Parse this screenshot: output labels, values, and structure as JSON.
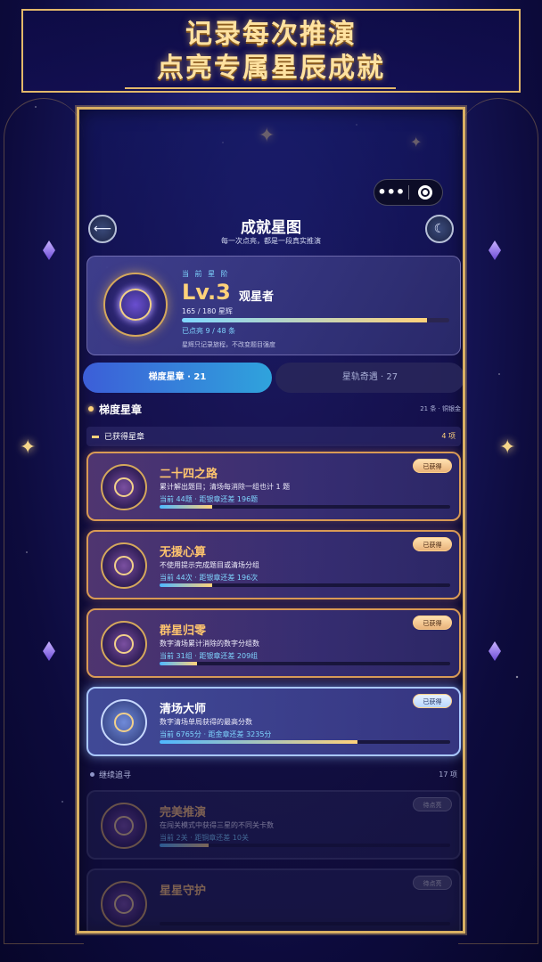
{
  "banner": {
    "line1": "记录每次推演",
    "line2": "点亮专属星辰成就"
  },
  "header": {
    "title": "成就星图",
    "subtitle": "每一次点亮，都是一段真实推演",
    "back_icon": "back-arrow-icon",
    "more_icon": "ellipsis-icon",
    "close_icon": "target-circle-icon"
  },
  "level": {
    "kicker": "当 前 星 阶",
    "value": "Lv.3",
    "name": "观星者",
    "points": "165 / 180 星辉",
    "progress": 0.917,
    "lit": "已点亮 9 / 48 条",
    "note": "星辉只记录旅程，不改变题目强度"
  },
  "tabs": [
    {
      "label": "梯度星章 · 21",
      "active": true
    },
    {
      "label": "星轨奇遇 · 27",
      "active": false
    }
  ],
  "section": {
    "title": "梯度星章",
    "meta": "21 条 · 铜银金"
  },
  "earned_group": {
    "title": "已获得星章",
    "count": "4 项"
  },
  "achievements": [
    {
      "name": "二十四之路",
      "desc": "累计解出题目；清场每消除一组也计 1 题",
      "progress_text": "当前 44题 · 距银章还差 196题",
      "progress": 0.18,
      "badge": "已获得",
      "tone": "gold"
    },
    {
      "name": "无援心算",
      "desc": "不使用提示完成题目或清场分组",
      "progress_text": "当前 44次 · 距银章还差 196次",
      "progress": 0.18,
      "badge": "已获得",
      "tone": "gold"
    },
    {
      "name": "群星归零",
      "desc": "数字清场累计消除的数字分组数",
      "progress_text": "当前 31组 · 距银章还差 209组",
      "progress": 0.13,
      "badge": "已获得",
      "tone": "gold"
    },
    {
      "name": "清场大师",
      "desc": "数字清场单局获得的最高分数",
      "progress_text": "当前 6765分 · 距金章还差 3235分",
      "progress": 0.68,
      "badge": "已获得",
      "tone": "blue"
    }
  ],
  "pending_group": {
    "title": "继续追寻",
    "count": "17 项"
  },
  "pending": [
    {
      "name": "完美推演",
      "desc": "在闯关模式中获得三星的不同关卡数",
      "progress_text": "当前 2关 · 距铜章还差 10关",
      "progress": 0.17,
      "badge": "待点亮"
    },
    {
      "name": "星星守护",
      "desc": "",
      "progress_text": "",
      "progress": 0,
      "badge": "待点亮"
    }
  ]
}
